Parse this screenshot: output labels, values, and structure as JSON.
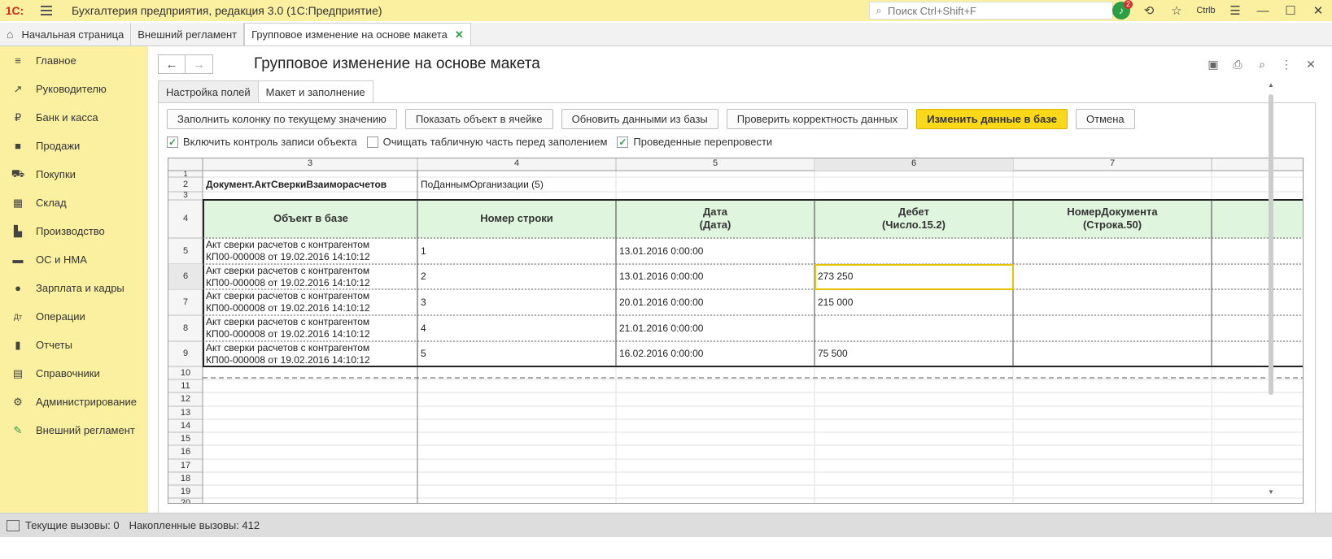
{
  "app": {
    "logo": "1С:",
    "title": "Бухгалтерия предприятия, редакция 3.0  (1С:Предприятие)",
    "search_placeholder": "Поиск Ctrl+Shift+F",
    "notification_count": "2",
    "user": "Ctrlb"
  },
  "tabs": [
    {
      "label": "Начальная страница"
    },
    {
      "label": "Внешний регламент"
    },
    {
      "label": "Групповое изменение на основе макета"
    }
  ],
  "sidebar": {
    "items": [
      {
        "label": "Главное",
        "icon": "menu-lines-icon"
      },
      {
        "label": "Руководителю",
        "icon": "trend-icon"
      },
      {
        "label": "Банк и касса",
        "icon": "ruble-coin-icon"
      },
      {
        "label": "Продажи",
        "icon": "shopping-bag-icon"
      },
      {
        "label": "Покупки",
        "icon": "cart-icon"
      },
      {
        "label": "Склад",
        "icon": "warehouse-icon"
      },
      {
        "label": "Производство",
        "icon": "factory-icon"
      },
      {
        "label": "ОС и НМА",
        "icon": "truck-icon"
      },
      {
        "label": "Зарплата и кадры",
        "icon": "person-icon"
      },
      {
        "label": "Операции",
        "icon": "dt-kt-icon"
      },
      {
        "label": "Отчеты",
        "icon": "bar-chart-icon"
      },
      {
        "label": "Справочники",
        "icon": "books-icon"
      },
      {
        "label": "Администрирование",
        "icon": "gear-icon"
      },
      {
        "label": "Внешний регламент",
        "icon": "pen-icon"
      }
    ]
  },
  "form": {
    "title": "Групповое изменение на основе макета",
    "subtabs": [
      "Настройка полей",
      "Макет и заполнение"
    ],
    "buttons": {
      "fill_column": "Заполнить колонку по текущему значению",
      "show_object": "Показать объект в ячейке",
      "refresh": "Обновить данными из базы",
      "check": "Проверить корректность данных",
      "apply": "Изменить данные в базе",
      "cancel": "Отмена"
    },
    "checkboxes": [
      {
        "label": "Включить контроль записи объекта",
        "checked": true
      },
      {
        "label": "Очищать табличную часть перед заполением",
        "checked": false
      },
      {
        "label": "Проведенные перепровести",
        "checked": true
      }
    ]
  },
  "sheet": {
    "col_headers": [
      "3",
      "4",
      "5",
      "6",
      "7"
    ],
    "row_numbers": [
      "1",
      "2",
      "3",
      "4",
      "5",
      "6",
      "7",
      "8",
      "9",
      "10",
      "11",
      "12",
      "13",
      "14",
      "15",
      "16",
      "17",
      "18",
      "19",
      "20"
    ],
    "row2": {
      "doc_type": "Документ.АктСверкиВзаиморасчетов",
      "mode": "ПоДаннымОрганизации (5)"
    },
    "table_headers": [
      {
        "line1": "Объект в базе",
        "line2": ""
      },
      {
        "line1": "Номер строки",
        "line2": ""
      },
      {
        "line1": "Дата",
        "line2": "(Дата)"
      },
      {
        "line1": "Дебет",
        "line2": "(Число.15.2)"
      },
      {
        "line1": "НомерДокумента",
        "line2": "(Строка.50)"
      }
    ],
    "rows": [
      {
        "obj1": "Акт сверки расчетов с контрагентом",
        "obj2": "КП00-000008 от 19.02.2016 14:10:12",
        "num": "1",
        "date": "13.01.2016 0:00:00",
        "debit": "",
        "docnum": ""
      },
      {
        "obj1": "Акт сверки расчетов с контрагентом",
        "obj2": "КП00-000008 от 19.02.2016 14:10:12",
        "num": "2",
        "date": "13.01.2016 0:00:00",
        "debit": "273 250",
        "docnum": ""
      },
      {
        "obj1": "Акт сверки расчетов с контрагентом",
        "obj2": "КП00-000008 от 19.02.2016 14:10:12",
        "num": "3",
        "date": "20.01.2016 0:00:00",
        "debit": "215 000",
        "docnum": ""
      },
      {
        "obj1": "Акт сверки расчетов с контрагентом",
        "obj2": "КП00-000008 от 19.02.2016 14:10:12",
        "num": "4",
        "date": "21.01.2016 0:00:00",
        "debit": "",
        "docnum": ""
      },
      {
        "obj1": "Акт сверки расчетов с контрагентом",
        "obj2": "КП00-000008 от 19.02.2016 14:10:12",
        "num": "5",
        "date": "16.02.2016 0:00:00",
        "debit": "75 500",
        "docnum": ""
      }
    ],
    "selected_row": "6",
    "selected_col": "6"
  },
  "status": {
    "current_calls": "Текущие вызовы: 0",
    "accumulated_calls": "Накопленные вызовы: 412"
  },
  "colors": {
    "accent_yellow": "#fbf0a0",
    "primary_button": "#fcd81b",
    "header_fill": "#dff5dd",
    "selection": "#e6c200",
    "brand_red": "#d9261c",
    "check_green": "#2e9e45"
  }
}
